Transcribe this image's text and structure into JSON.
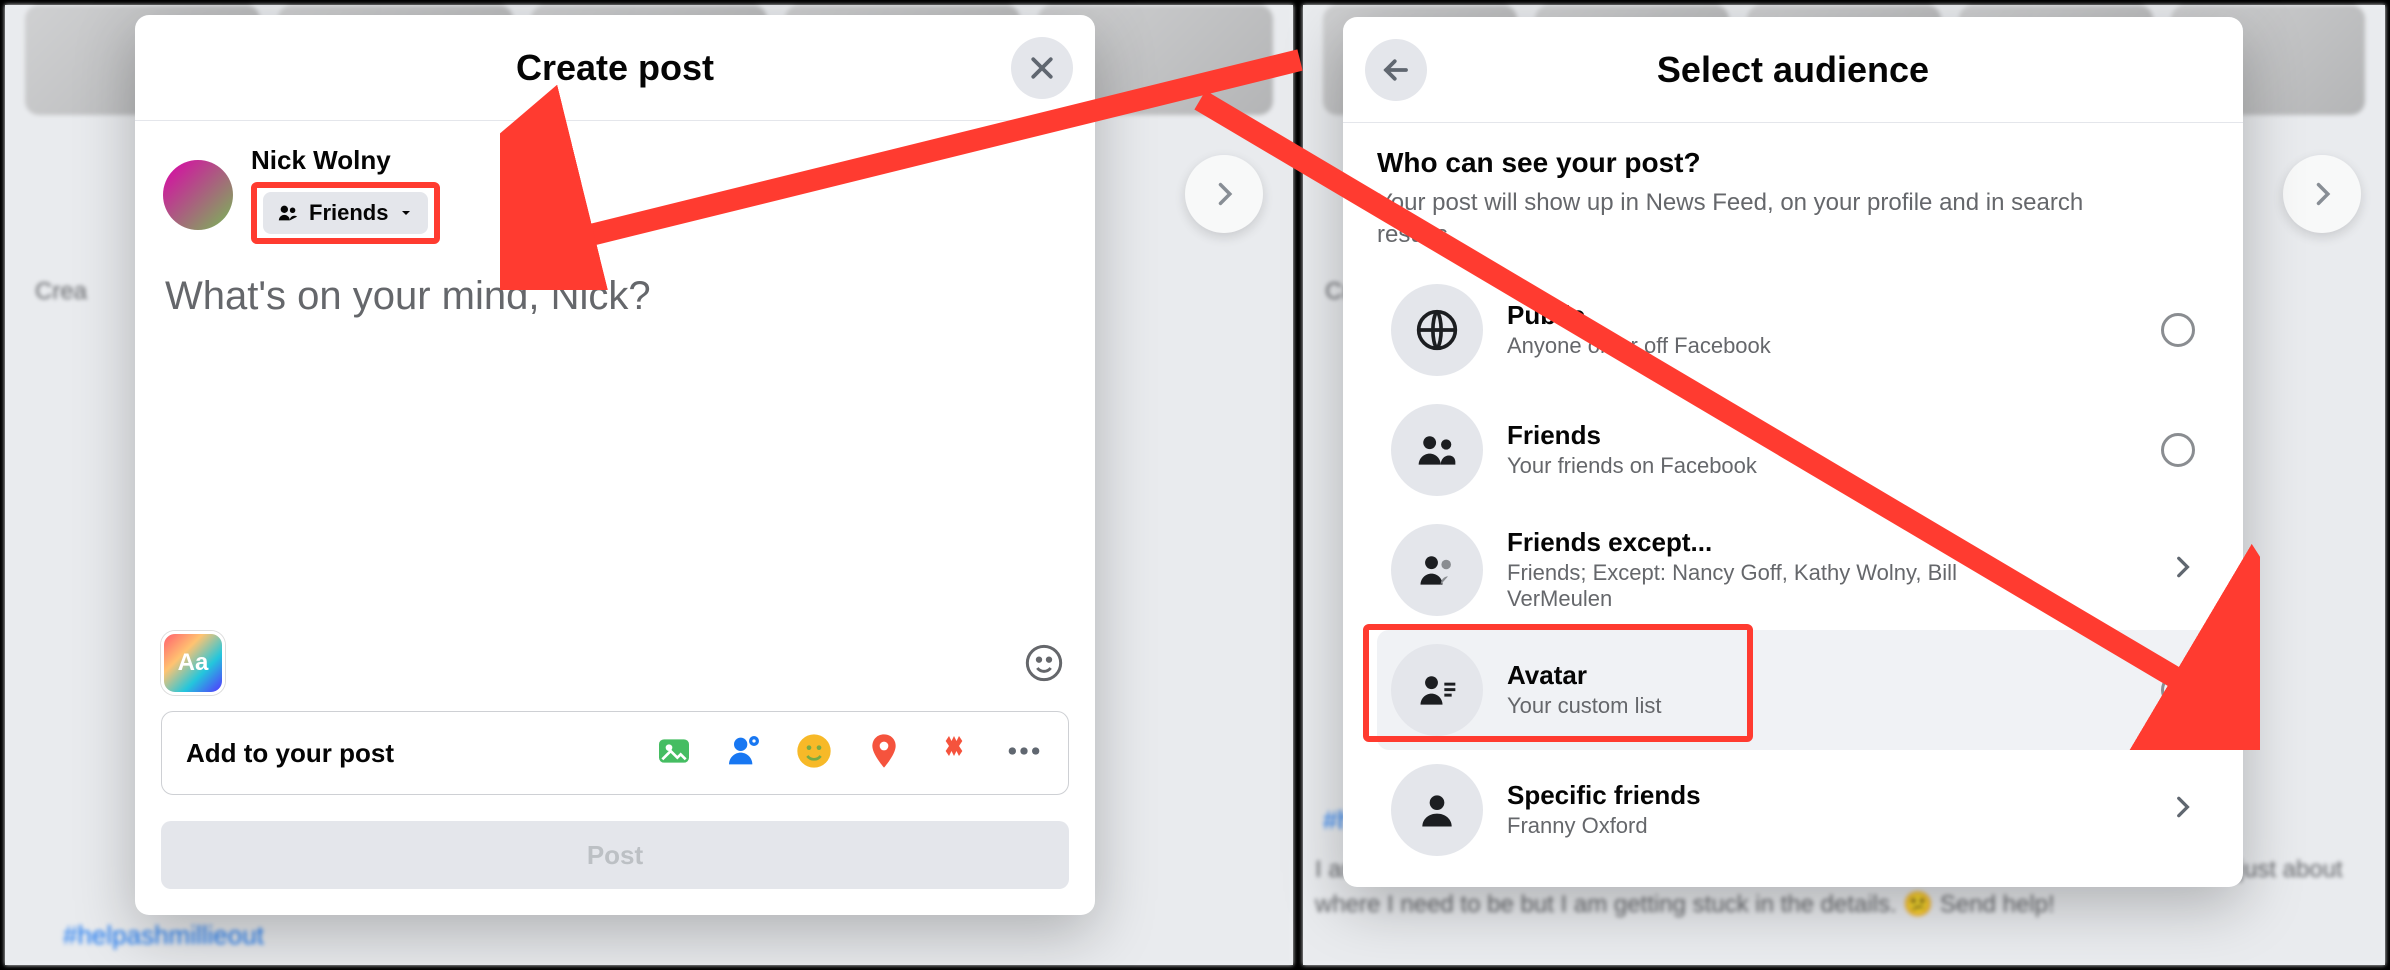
{
  "left": {
    "title": "Create post",
    "user_name": "Nick Wolny",
    "audience_label": "Friends",
    "placeholder": "What's on your mind, Nick?",
    "aa_label": "Aa",
    "add_label": "Add to your post",
    "post_label": "Post",
    "bg_create_label": "Crea",
    "bg_hashtag": "#helpashmillieout"
  },
  "right": {
    "title": "Select audience",
    "question": "Who can see your post?",
    "description": "Your post will show up in News Feed, on your profile and in search results.",
    "options": [
      {
        "title": "Public",
        "desc": "Anyone on or off Facebook",
        "tail": "radio"
      },
      {
        "title": "Friends",
        "desc": "Your friends on Facebook",
        "tail": "radio"
      },
      {
        "title": "Friends except...",
        "desc": "Friends; Except: Nancy Goff, Kathy Wolny, Bill VerMeulen",
        "tail": "chev"
      },
      {
        "title": "Avatar",
        "desc": "Your custom list",
        "tail": "radio"
      },
      {
        "title": "Specific friends",
        "desc": "Franny Oxford",
        "tail": "chev"
      }
    ],
    "bg_create_label": "Crea",
    "bg_hel": "#hel",
    "bg_para": "I am looking to connect with someone who has membership service business. 🤔 I am just about where I need to be but I am getting stuck in the details. 😕 Send help!"
  }
}
